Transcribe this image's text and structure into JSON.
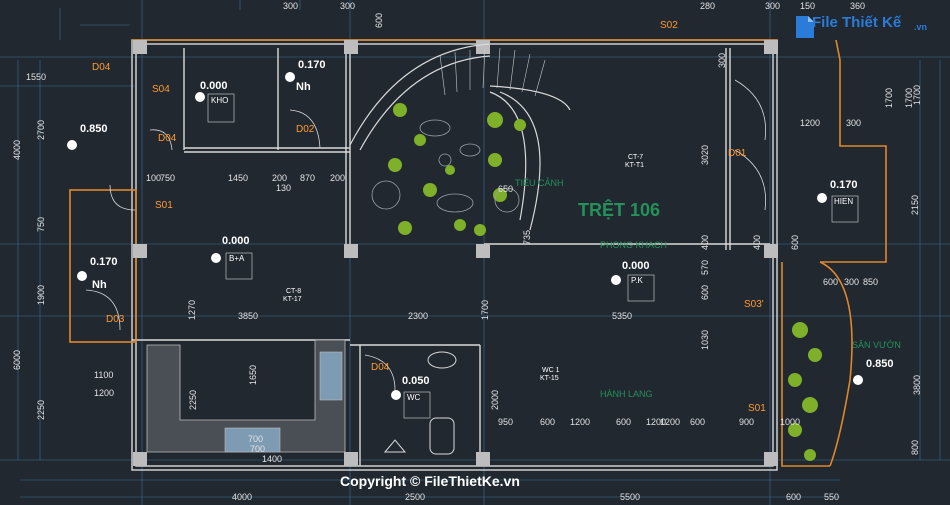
{
  "brand": {
    "logo_text": "File Thiết Kế",
    "logo_tld": ".vn"
  },
  "copyright": "Copyright © FileThietKe.vn",
  "floor": {
    "title": "TRỆT 106",
    "subtitle": "PHONG KHACH",
    "garden": "TIỂU CẢNH",
    "san_vuon": "SÂN VƯỜN",
    "hanh_lang": "HÀNH LANG"
  },
  "levels": {
    "kho": "0.000",
    "nh_top": "0.170",
    "c1": "0.850",
    "bep": "0.000",
    "nh_left": "0.170",
    "pk": "0.000",
    "hien": "0.170",
    "wc": "0.050",
    "san_vuon": "0.850"
  },
  "room_tags": {
    "kho": "KHO",
    "bep": "B+A",
    "pk": "P.K",
    "hien": "HIEN",
    "wc": "WC"
  },
  "doors": {
    "d04a": "D04",
    "s04": "S04",
    "d04b": "D04",
    "d02": "D02",
    "s01a": "S01",
    "d03": "D03",
    "d01": "D01",
    "s02": "S02",
    "s03": "S03'",
    "d04c": "D04",
    "s01b": "S01"
  },
  "nh": "Nh",
  "sections": {
    "ct7": "CT-7",
    "kt11": "KT-T1",
    "ct8": "CT-8",
    "kt17": "KT-17",
    "wc1": "WC 1",
    "kt15": "KT-15"
  },
  "dims": {
    "top": [
      "300",
      "600",
      "280",
      "360",
      "1700",
      "150",
      "300",
      "300"
    ],
    "bottom": [
      "4000",
      "2500",
      "5500",
      "600",
      "550"
    ],
    "left": [
      "1550",
      "2700",
      "4000",
      "750",
      "1900",
      "2250",
      "1100",
      "1200",
      "6000"
    ],
    "right": [
      "300",
      "1700",
      "2150",
      "850",
      "600",
      "3800",
      "800",
      "1700",
      "1200",
      "300"
    ],
    "inner": [
      "750",
      "1450",
      "200",
      "870",
      "200",
      "130",
      "3850",
      "2300",
      "5350",
      "950",
      "600",
      "1200",
      "600",
      "1200",
      "600",
      "900",
      "400",
      "650",
      "1270",
      "1650",
      "2250",
      "3020",
      "570",
      "1030",
      "2000",
      "1700",
      "735",
      "400",
      "600",
      "300",
      "1200",
      "100",
      "600",
      "1000",
      "700",
      "700",
      "1400"
    ]
  }
}
